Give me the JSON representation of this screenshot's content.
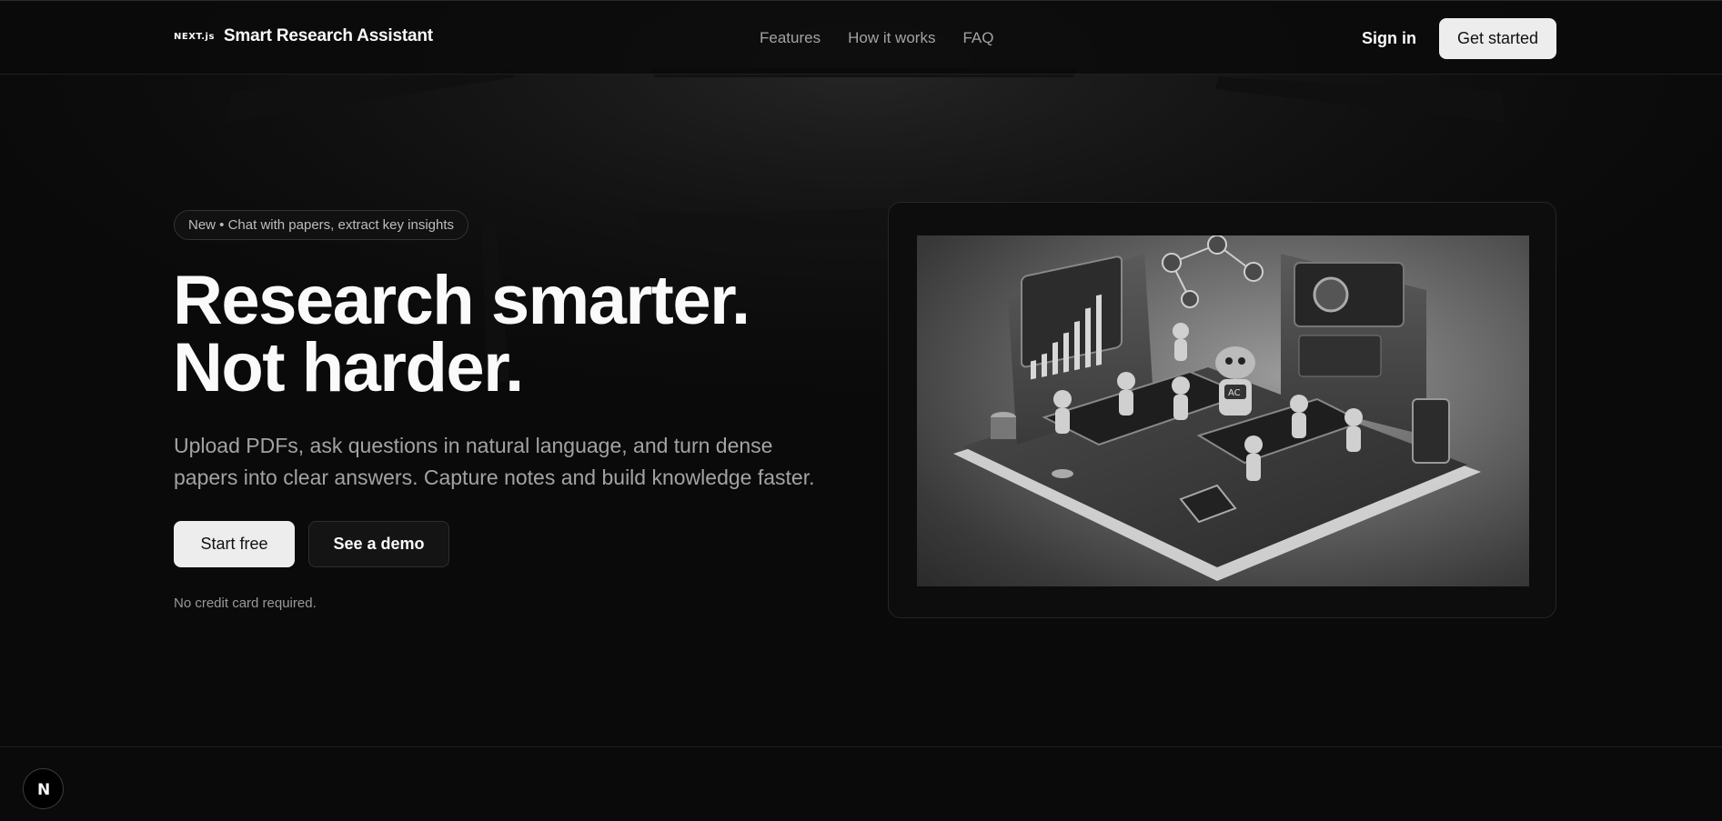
{
  "brand": {
    "logo_text": "NEXT.js",
    "name": "Smart Research Assistant"
  },
  "nav": {
    "links": [
      "Features",
      "How it works",
      "FAQ"
    ],
    "sign_in": "Sign in",
    "get_started": "Get started"
  },
  "hero": {
    "badge": "New • Chat with papers, extract key insights",
    "title": "Research smarter. Not harder.",
    "subtitle": "Upload PDFs, ask questions in natural language, and turn dense papers into clear answers. Capture notes and build knowledge faster.",
    "primary_cta": "Start free",
    "secondary_cta": "See a demo",
    "note": "No credit card required."
  },
  "illustration": {
    "screen_label": "AC"
  },
  "dev_badge": {
    "letter": "N"
  },
  "colors": {
    "background": "#0a0a0a",
    "primary_button": "#ededed",
    "muted_text": "#a3a3a3"
  }
}
